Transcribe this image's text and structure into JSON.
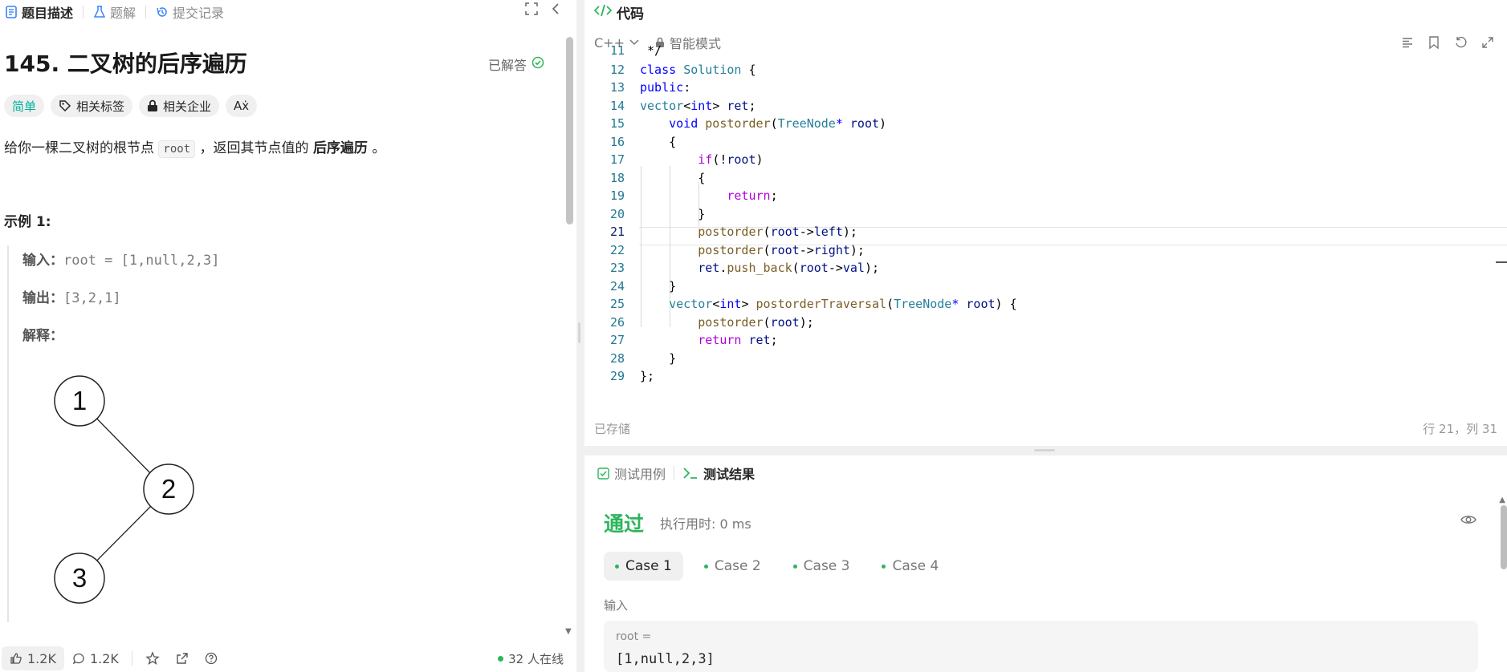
{
  "left_tabs": {
    "description": "题目描述",
    "solution": "题解",
    "submissions": "提交记录"
  },
  "problem": {
    "title": "145. 二叉树的后序遍历",
    "solved_label": "已解答",
    "difficulty": "简单",
    "tags_label": "相关标签",
    "companies_label": "相关企业",
    "desc_prefix": "给你一棵二叉树的根节点",
    "desc_code": "root",
    "desc_middle": "，返回其节点值的",
    "desc_bold": "后序遍历",
    "desc_suffix": "。",
    "example_title": "示例 1:",
    "input_label": "输入：",
    "input_value": "root = [1,null,2,3]",
    "output_label": "输出：",
    "output_value": "[3,2,1]",
    "explain_label": "解释：",
    "tree_nodes": [
      "1",
      "2",
      "3"
    ]
  },
  "left_bottom": {
    "likes": "1.2K",
    "comments": "1.2K",
    "online": "32 人在线"
  },
  "code": {
    "header": "代码",
    "language": "C++",
    "mode": "智能模式",
    "saved": "已存储",
    "cursor_pos": "行 21，列 31"
  },
  "test": {
    "tab_cases": "测试用例",
    "tab_results": "测试结果",
    "status": "通过",
    "runtime": "执行用时: 0 ms",
    "cases": [
      "Case 1",
      "Case 2",
      "Case 3",
      "Case 4"
    ],
    "input_label": "输入",
    "var_label": "root =",
    "var_value": "[1,null,2,3]"
  },
  "colors": {
    "accent_green": "#2db55d",
    "easy_teal": "#00af9b"
  }
}
